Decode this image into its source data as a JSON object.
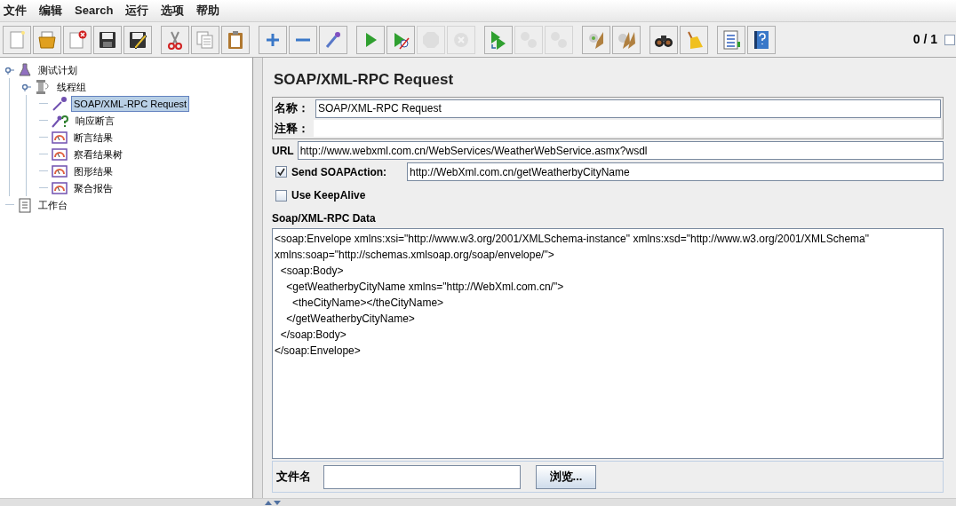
{
  "menu": [
    "文件",
    "编辑",
    "Search",
    "运行",
    "选项",
    "帮助"
  ],
  "toolbar": [
    [
      {
        "kind": "new",
        "disabled": false
      },
      {
        "kind": "open",
        "disabled": false
      },
      {
        "kind": "close",
        "disabled": false
      },
      {
        "kind": "save",
        "disabled": false
      },
      {
        "kind": "save-as",
        "disabled": false
      }
    ],
    [
      {
        "kind": "cut",
        "disabled": false
      },
      {
        "kind": "copy",
        "disabled": false
      },
      {
        "kind": "paste",
        "disabled": false
      }
    ],
    [
      {
        "kind": "expand",
        "disabled": false
      },
      {
        "kind": "collapse",
        "disabled": false
      },
      {
        "kind": "toggle",
        "disabled": false
      }
    ],
    [
      {
        "kind": "start",
        "disabled": false
      },
      {
        "kind": "start-no-timers",
        "disabled": false
      },
      {
        "kind": "stop",
        "disabled": true
      },
      {
        "kind": "shutdown",
        "disabled": true
      }
    ],
    [
      {
        "kind": "remote-start",
        "disabled": false
      },
      {
        "kind": "remote-stop",
        "disabled": true
      },
      {
        "kind": "remote-shutdown",
        "disabled": true
      }
    ],
    [
      {
        "kind": "clear",
        "disabled": false
      },
      {
        "kind": "clear-all",
        "disabled": false
      }
    ],
    [
      {
        "kind": "search",
        "disabled": false
      },
      {
        "kind": "reset-search",
        "disabled": false
      }
    ],
    [
      {
        "kind": "function-helper",
        "disabled": false
      },
      {
        "kind": "help",
        "disabled": false
      }
    ]
  ],
  "thread_count": "0 / 1",
  "tree": [
    {
      "label": "测试计划",
      "kind": "plan",
      "selected": false,
      "expanded": true,
      "children": [
        {
          "label": "线程组",
          "kind": "thread-group",
          "selected": false,
          "expanded": true,
          "children": [
            {
              "label": "SOAP/XML-RPC Request",
              "kind": "sampler",
              "selected": true
            },
            {
              "label": "响应断言",
              "kind": "assertion",
              "selected": false
            },
            {
              "label": "断言结果",
              "kind": "listener",
              "selected": false
            },
            {
              "label": "察看结果树",
              "kind": "listener",
              "selected": false
            },
            {
              "label": "图形结果",
              "kind": "listener",
              "selected": false
            },
            {
              "label": "聚合报告",
              "kind": "listener",
              "selected": false
            }
          ]
        }
      ]
    },
    {
      "label": "工作台",
      "kind": "workbench",
      "selected": false
    }
  ],
  "panel": {
    "title": "SOAP/XML-RPC Request",
    "name_label": "名称：",
    "name_value": "SOAP/XML-RPC Request",
    "comment_label": "注释：",
    "url_label": "URL",
    "url_value": "http://www.webxml.com.cn/WebServices/WeatherWebService.asmx?wsdl",
    "send_soapaction": {
      "label": "Send SOAPAction:",
      "checked": true,
      "value": "http://WebXml.com.cn/getWeatherbyCityName"
    },
    "keepalive": {
      "label": "Use KeepAlive",
      "checked": false
    },
    "data_label": "Soap/XML-RPC Data",
    "data_lines": [
      "<soap:Envelope xmlns:xsi=\"http://www.w3.org/2001/XMLSchema-instance\" xmlns:xsd=\"http://www.w3.org/2001/XMLSchema\" xmlns:soap=\"http://schemas.xmlsoap.org/soap/envelope/\">",
      "  <soap:Body>",
      "    <getWeatherbyCityName xmlns=\"http://WebXml.com.cn/\">",
      "      <theCityName></theCityName>",
      "    </getWeatherbyCityName>",
      "  </soap:Body>",
      "</soap:Envelope>"
    ],
    "file_label": "文件名",
    "browse_button": "浏览..."
  }
}
